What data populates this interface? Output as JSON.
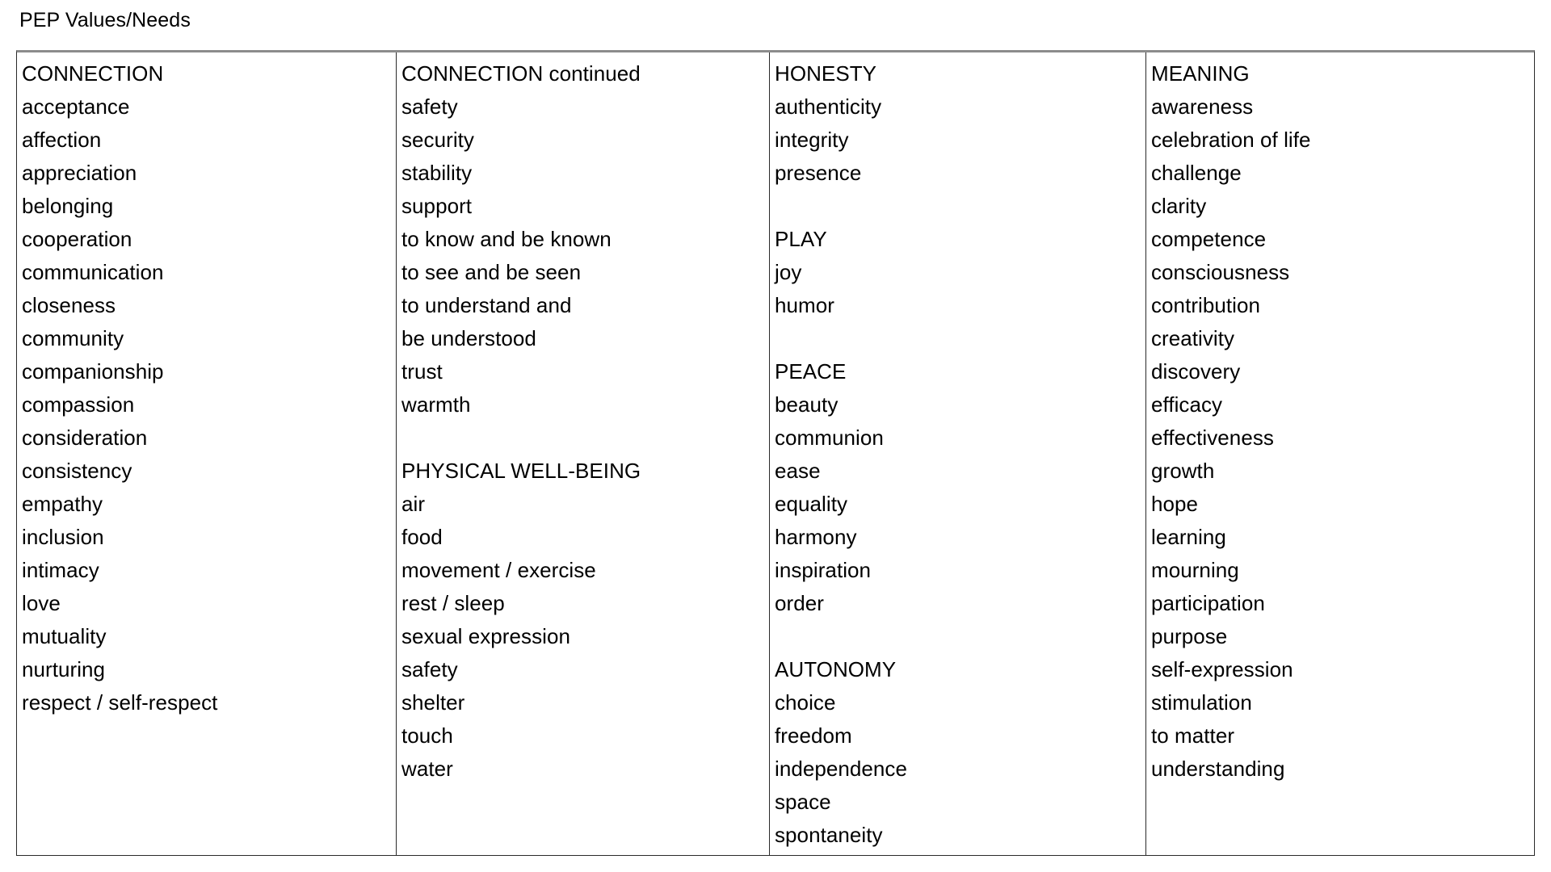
{
  "document": {
    "title": "PEP Values/Needs"
  },
  "table": {
    "columns": [
      {
        "id": "column-1",
        "header": "CONNECTION",
        "entries": [
          {
            "text": "CONNECTION",
            "type": "heading"
          },
          {
            "text": "acceptance",
            "type": "item"
          },
          {
            "text": "affection",
            "type": "item"
          },
          {
            "text": "appreciation",
            "type": "item"
          },
          {
            "text": "belonging",
            "type": "item"
          },
          {
            "text": "cooperation",
            "type": "item"
          },
          {
            "text": "communication",
            "type": "item"
          },
          {
            "text": "closeness",
            "type": "item"
          },
          {
            "text": "community",
            "type": "item"
          },
          {
            "text": "companionship",
            "type": "item"
          },
          {
            "text": "compassion",
            "type": "item"
          },
          {
            "text": "consideration",
            "type": "item"
          },
          {
            "text": "consistency",
            "type": "item"
          },
          {
            "text": "empathy",
            "type": "item"
          },
          {
            "text": "inclusion",
            "type": "item"
          },
          {
            "text": "intimacy",
            "type": "item"
          },
          {
            "text": "love",
            "type": "item"
          },
          {
            "text": "mutuality",
            "type": "item"
          },
          {
            "text": "nurturing",
            "type": "item"
          },
          {
            "text": "respect / self-respect",
            "type": "item"
          }
        ]
      },
      {
        "id": "column-2",
        "header": "CONNECTION continued",
        "entries": [
          {
            "text": "CONNECTION continued",
            "type": "heading"
          },
          {
            "text": "safety",
            "type": "item"
          },
          {
            "text": "security",
            "type": "item"
          },
          {
            "text": "stability",
            "type": "item"
          },
          {
            "text": "support",
            "type": "item"
          },
          {
            "text": "to know and be known",
            "type": "item"
          },
          {
            "text": "to see and be seen",
            "type": "item"
          },
          {
            "text": "to understand and",
            "type": "item"
          },
          {
            "text": "be understood",
            "type": "item"
          },
          {
            "text": "trust",
            "type": "item"
          },
          {
            "text": "warmth",
            "type": "item"
          },
          {
            "text": "",
            "type": "spacer"
          },
          {
            "text": "PHYSICAL WELL-BEING",
            "type": "heading"
          },
          {
            "text": "air",
            "type": "item"
          },
          {
            "text": "food",
            "type": "item"
          },
          {
            "text": "movement / exercise",
            "type": "item"
          },
          {
            "text": "rest / sleep",
            "type": "item"
          },
          {
            "text": "sexual expression",
            "type": "item"
          },
          {
            "text": "safety",
            "type": "item"
          },
          {
            "text": "shelter",
            "type": "item"
          },
          {
            "text": "touch",
            "type": "item"
          },
          {
            "text": "water",
            "type": "item"
          }
        ]
      },
      {
        "id": "column-3",
        "header": "HONESTY",
        "entries": [
          {
            "text": "HONESTY",
            "type": "heading"
          },
          {
            "text": "authenticity",
            "type": "item"
          },
          {
            "text": "integrity",
            "type": "item"
          },
          {
            "text": "presence",
            "type": "item"
          },
          {
            "text": "",
            "type": "spacer"
          },
          {
            "text": "PLAY",
            "type": "heading"
          },
          {
            "text": "joy",
            "type": "item"
          },
          {
            "text": "humor",
            "type": "item"
          },
          {
            "text": "",
            "type": "spacer"
          },
          {
            "text": "PEACE",
            "type": "heading"
          },
          {
            "text": "beauty",
            "type": "item"
          },
          {
            "text": "communion",
            "type": "item"
          },
          {
            "text": "ease",
            "type": "item"
          },
          {
            "text": "equality",
            "type": "item"
          },
          {
            "text": "harmony",
            "type": "item"
          },
          {
            "text": "inspiration",
            "type": "item"
          },
          {
            "text": "order",
            "type": "item"
          },
          {
            "text": "",
            "type": "spacer"
          },
          {
            "text": "AUTONOMY",
            "type": "heading"
          },
          {
            "text": "choice",
            "type": "item"
          },
          {
            "text": "freedom",
            "type": "item"
          },
          {
            "text": "independence",
            "type": "item"
          },
          {
            "text": "space",
            "type": "item"
          },
          {
            "text": "spontaneity",
            "type": "item"
          }
        ]
      },
      {
        "id": "column-4",
        "header": "MEANING",
        "entries": [
          {
            "text": "MEANING",
            "type": "heading"
          },
          {
            "text": "awareness",
            "type": "item"
          },
          {
            "text": "celebration of life",
            "type": "item"
          },
          {
            "text": "challenge",
            "type": "item"
          },
          {
            "text": "clarity",
            "type": "item"
          },
          {
            "text": "competence",
            "type": "item"
          },
          {
            "text": "consciousness",
            "type": "item"
          },
          {
            "text": "contribution",
            "type": "item"
          },
          {
            "text": "creativity",
            "type": "item"
          },
          {
            "text": "discovery",
            "type": "item"
          },
          {
            "text": "efficacy",
            "type": "item"
          },
          {
            "text": "effectiveness",
            "type": "item"
          },
          {
            "text": "growth",
            "type": "item"
          },
          {
            "text": "hope",
            "type": "item"
          },
          {
            "text": "learning",
            "type": "item"
          },
          {
            "text": "mourning",
            "type": "item"
          },
          {
            "text": "participation",
            "type": "item"
          },
          {
            "text": "purpose",
            "type": "item"
          },
          {
            "text": "self-expression",
            "type": "item"
          },
          {
            "text": "stimulation",
            "type": "item"
          },
          {
            "text": "to matter",
            "type": "item"
          },
          {
            "text": "understanding",
            "type": "item"
          }
        ]
      }
    ]
  },
  "colors": {
    "text": "#000000",
    "background": "#ffffff",
    "border": "#2a2a2a",
    "top_border": "#8c8c8c"
  }
}
